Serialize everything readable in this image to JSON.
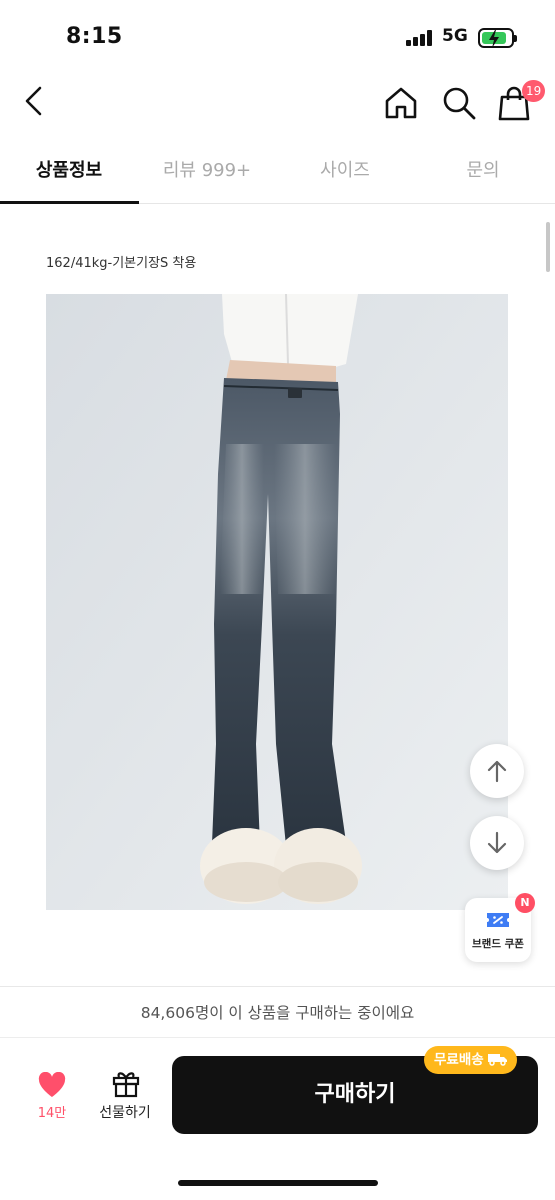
{
  "status_bar": {
    "time": "8:15",
    "network": "5G",
    "battery": {
      "level": 0.7,
      "charging": true
    }
  },
  "header": {
    "icons": [
      "back-icon",
      "home-icon",
      "search-icon",
      "shopping-bag-icon"
    ],
    "cart_badge": "19"
  },
  "tabs": [
    {
      "label": "상품정보",
      "active": true
    },
    {
      "label": "리뷰 999+",
      "active": false
    },
    {
      "label": "사이즈",
      "active": false
    },
    {
      "label": "문의",
      "active": false
    }
  ],
  "content": {
    "caption": "162/41kg-기본기장S 착용"
  },
  "floating": {
    "scroll_up_icon": "arrow-up-icon",
    "scroll_down_icon": "arrow-down-icon",
    "coupon_label": "브랜드 쿠폰",
    "coupon_badge": "N"
  },
  "bottom": {
    "buyers_text": "84,606명이 이 상품을 구매하는 중이에요",
    "like_count": "14만",
    "gift_label": "선물하기",
    "buy_label": "구매하기",
    "free_shipping_label": "무료배송"
  },
  "colors": {
    "accent_pink": "#ff5068",
    "free_shipping": "#ffb81c",
    "buy_button": "#111111"
  }
}
